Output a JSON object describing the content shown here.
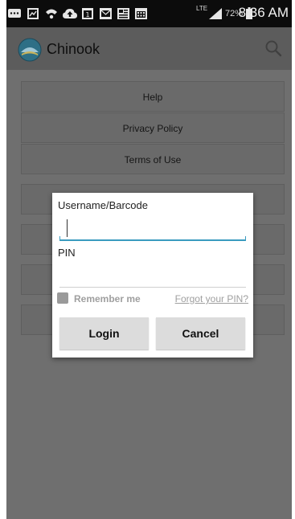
{
  "status_bar": {
    "time": "8:36 AM",
    "battery_percent": "72%",
    "network": "LTE",
    "icons": [
      "message-icon",
      "image-icon",
      "wifi-icon",
      "cloud-upload-icon",
      "calendar-icon",
      "mail-icon",
      "news-icon",
      "calendar-grid-icon",
      "signal-icon",
      "battery-icon"
    ]
  },
  "action_bar": {
    "title": "Chinook",
    "logo_icon": "chinook-logo-icon",
    "search_icon": "search-icon"
  },
  "menu": {
    "items": [
      "Help",
      "Privacy Policy",
      "Terms of Use"
    ]
  },
  "login_dialog": {
    "username_label": "Username/Barcode",
    "username_value": "",
    "pin_label": "PIN",
    "pin_value": "",
    "remember_label": "Remember me",
    "remember_checked": false,
    "forgot_link": "Forgot your PIN?",
    "login_button": "Login",
    "cancel_button": "Cancel"
  },
  "colors": {
    "accent": "#3a9bbf",
    "dim_overlay": "#6f6f6f",
    "dialog_bg": "#ffffff",
    "button_bg": "#dcdcdc"
  }
}
